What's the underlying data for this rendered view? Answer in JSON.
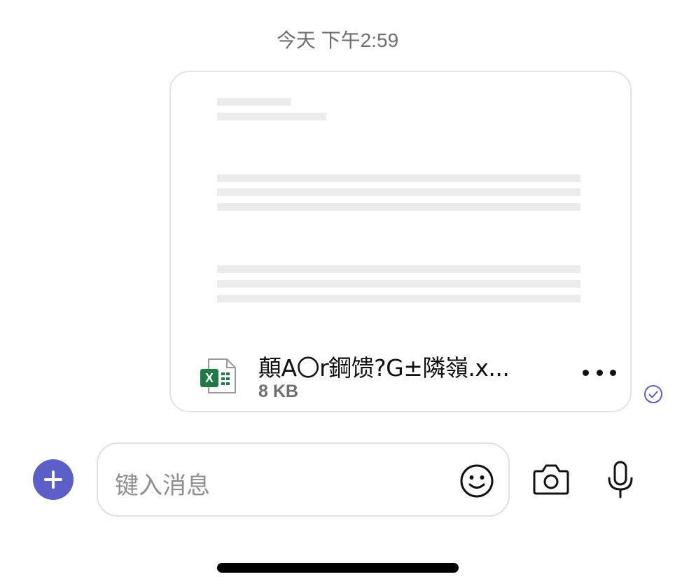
{
  "conversation": {
    "timestamp": "今天 下午2:59"
  },
  "file_message": {
    "file_name": "顛A〇r鋼馈?G±隣嶺.x...",
    "file_size": "8 KB",
    "file_type_icon": "excel-icon",
    "more_icon": "more-horizontal-icon",
    "status_icon": "read-check-icon"
  },
  "composer": {
    "add_icon": "plus-icon",
    "placeholder": "键入消息",
    "emoji_icon": "emoji-icon",
    "camera_icon": "camera-icon",
    "mic_icon": "microphone-icon"
  },
  "colors": {
    "accent": "#5b5fc7",
    "excel_green": "#1f7a45",
    "muted_text": "#6e6e73",
    "placeholder": "#8e8e93"
  }
}
